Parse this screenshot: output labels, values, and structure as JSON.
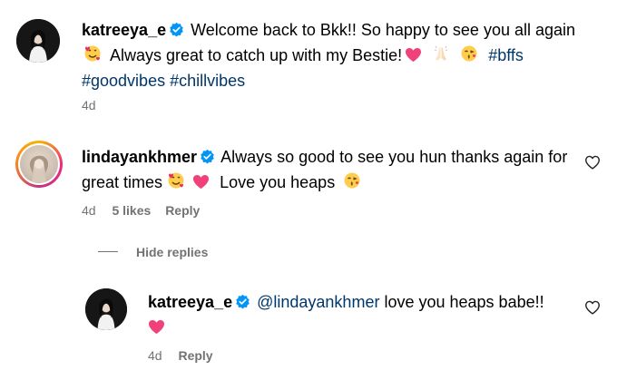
{
  "post": {
    "username": "katreeya_e",
    "caption_part1": "Welcome back to Bkk!! So happy to see you all again",
    "caption_part2": "Always great to catch up with my Bestie!",
    "hashtags": [
      "#bffs",
      "#goodvibes",
      "#chillvibes"
    ],
    "time": "4d"
  },
  "comment": {
    "username": "lindayankhmer",
    "text_part1": "Always so good to see you hun thanks again for great times",
    "text_part2": "Love you heaps",
    "time": "4d",
    "likes": "5 likes",
    "reply_label": "Reply"
  },
  "replies_toggle": {
    "label": "Hide replies"
  },
  "reply": {
    "username": "katreeya_e",
    "mention": "@lindayankhmer",
    "text": "love you heaps babe!!",
    "time": "4d",
    "reply_label": "Reply"
  },
  "colors": {
    "link": "#00376b",
    "meta": "#737373",
    "verified": "#0095f6",
    "heart_emoji": "#f0417a"
  },
  "icons": [
    "verified-badge-icon",
    "like-heart-icon",
    "smiling-hearts-emoji",
    "heart-emoji",
    "praying-hands-emoji",
    "kiss-emoji"
  ]
}
